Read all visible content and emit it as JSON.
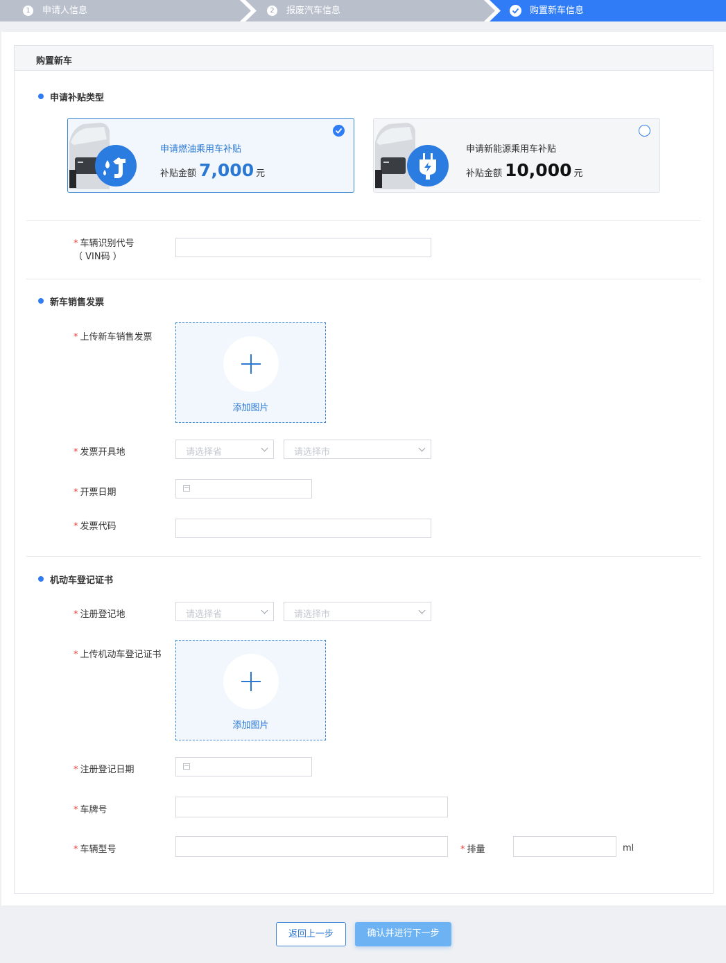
{
  "steps": [
    {
      "num": "1",
      "label": "申请人信息"
    },
    {
      "num": "2",
      "label": "报废汽车信息"
    },
    {
      "num": "",
      "label": "购置新车信息"
    }
  ],
  "card_title": "购置新车",
  "subsidy": {
    "section_title": "申请补贴类型",
    "options": [
      {
        "title": "申请燃油乘用车补贴",
        "amount_label": "补贴金额",
        "amount": "7,000",
        "unit": "元",
        "selected": true
      },
      {
        "title": "申请新能源乘用车补贴",
        "amount_label": "补贴金额",
        "amount": "10,000",
        "unit": "元",
        "selected": false
      }
    ]
  },
  "vin": {
    "label_line1": "车辆识别代号",
    "label_line2": "（ VIN码 ）",
    "value": ""
  },
  "invoice": {
    "section_title": "新车销售发票",
    "upload_label": "上传新车销售发票",
    "upload_text": "添加图片",
    "place_label": "发票开具地",
    "province_placeholder": "请选择省",
    "city_placeholder": "请选择市",
    "date_label": "开票日期",
    "code_label": "发票代码"
  },
  "registration": {
    "section_title": "机动车登记证书",
    "place_label": "注册登记地",
    "province_placeholder": "请选择省",
    "city_placeholder": "请选择市",
    "upload_label": "上传机动车登记证书",
    "upload_text": "添加图片",
    "date_label": "注册登记日期",
    "plate_label": "车牌号",
    "model_label": "车辆型号",
    "displacement_label": "排量",
    "displacement_unit": "ml"
  },
  "required_mark": "*",
  "footer": {
    "back_label": "返回上一步",
    "next_label": "确认并进行下一步"
  },
  "colors": {
    "accent": "#2f7cf6",
    "step_inactive": "#b9bfcb",
    "required": "#e8413b",
    "next_button": "#6db3f4"
  }
}
